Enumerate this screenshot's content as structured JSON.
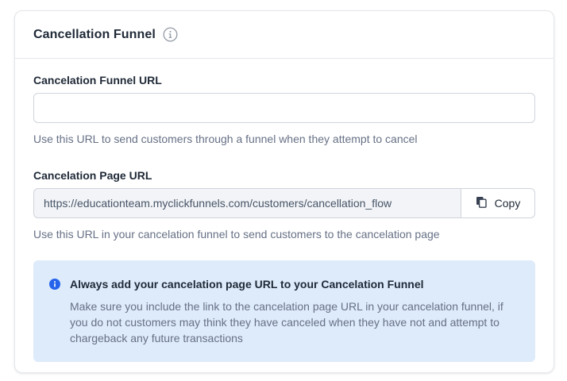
{
  "card": {
    "title": "Cancellation Funnel",
    "icon": "info-circle-outline-icon"
  },
  "funnel_url": {
    "label": "Cancelation Funnel URL",
    "value": "",
    "placeholder": "",
    "help": "Use this URL to send customers through a funnel when they attempt to cancel"
  },
  "page_url": {
    "label": "Cancelation Page URL",
    "value": "https://educationteam.myclickfunnels.com/customers/cancellation_flow",
    "copy_label": "Copy",
    "copy_icon": "copy-icon",
    "help": "Use this URL in your cancelation funnel to send customers to the cancelation page"
  },
  "alert": {
    "icon": "info-circle-solid-icon",
    "title": "Always add your cancelation page URL to your Cancelation Funnel",
    "text": "Make sure you include the link to the cancelation page URL in your cancelation funnel, if you do not customers may think they have canceled when they have not and attempt to chargeback any future transactions"
  },
  "colors": {
    "accent_blue": "#2563eb",
    "alert_bg": "#deebfb",
    "muted_text": "#667085",
    "border": "#cfd4dc"
  }
}
